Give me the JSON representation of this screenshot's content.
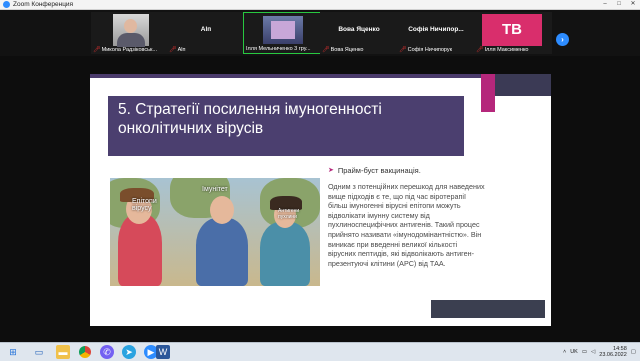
{
  "window": {
    "title": "Zoom Конференция",
    "controls": [
      "–",
      "□",
      "✕"
    ]
  },
  "participants": [
    {
      "id": "p1",
      "display": "",
      "label": "Микола Радзіковськ..."
    },
    {
      "id": "p2",
      "display": "Alп",
      "label": "Alп"
    },
    {
      "id": "p3",
      "display": "",
      "label": "Ілля Мельниченко 3 гру..."
    },
    {
      "id": "p4",
      "display": "Вова Яценко",
      "label": "Вова Яценко"
    },
    {
      "id": "p5",
      "display": "Софія Ничипор...",
      "label": "Софія Ничипорук"
    },
    {
      "id": "p6",
      "display": "ТВ",
      "label": "Ілля Максименко"
    }
  ],
  "icons": {
    "next_participants": "chevron-right-icon",
    "muted_mic": "mic-muted-icon"
  },
  "slide": {
    "title": "5. Стратегії посилення імуногенності онколітичних вірусів",
    "bullet": "Прайм-буст вакцинація.",
    "body": "Одним з потенційних перешкод для наведених вище підходів є те, що під час віротерапії більш імуногенні вірусні епітопи можуть відволікати імунну систему від пухлиноспецифічних антигенів. Такий процес прийнято називати «імунодомінантністю». Він виникає при введенні великої кількості вірусних пептидів, які відволікають антиген-презентуючі клітини (APC) від ТАА.",
    "photo_labels": {
      "left": "Епітопи вірусу",
      "middle": "Імунітет",
      "right": "Антигени пухлини"
    }
  },
  "taskbar": {
    "apps": [
      "start",
      "search",
      "explorer",
      "chrome",
      "viber",
      "telegram",
      "zoom",
      "word"
    ],
    "language": "UK",
    "time": "14:58",
    "date": "23.06.2022"
  },
  "colors": {
    "slide_title_band": "#4b3f6f",
    "accent_magenta": "#b5277b",
    "active_speaker_border": "#28c840",
    "zoom_blue": "#2d8cff"
  }
}
